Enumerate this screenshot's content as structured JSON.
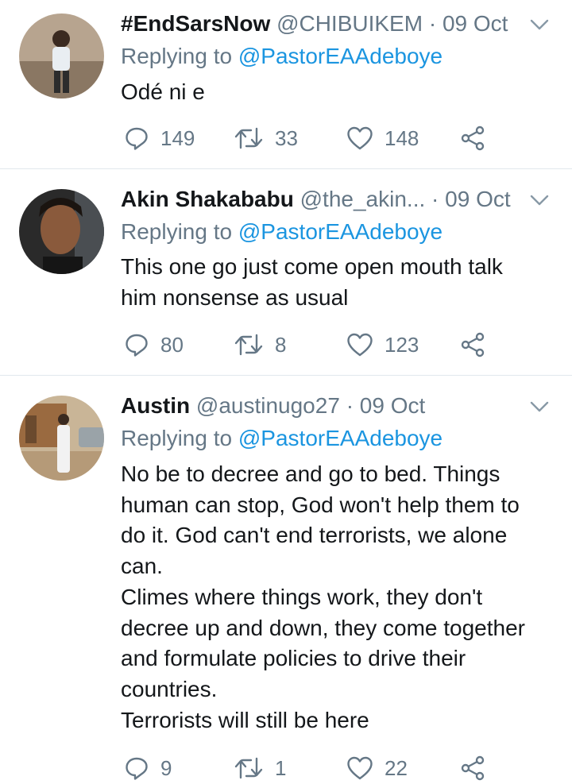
{
  "tweets": [
    {
      "name": "#EndSarsNow",
      "handle": "@CHIBUIKEM",
      "separator": "·",
      "date": "09 Oct",
      "replying_prefix": "Replying to",
      "replying_to": "@PastorEAAdeboye",
      "text": "Odé ni e",
      "replies": "149",
      "retweets": "33",
      "likes": "148"
    },
    {
      "name": "Akin Shakababu",
      "handle": "@the_akin...",
      "separator": "·",
      "date": "09 Oct",
      "replying_prefix": "Replying to",
      "replying_to": "@PastorEAAdeboye",
      "text": "This one go just come open mouth talk\nhim nonsense as usual",
      "replies": "80",
      "retweets": "8",
      "likes": "123"
    },
    {
      "name": "Austin",
      "handle": "@austinugo27",
      "separator": "·",
      "date": "09 Oct",
      "replying_prefix": "Replying to",
      "replying_to": "@PastorEAAdeboye",
      "text": "No be to decree and go to bed. Things\nhuman can stop, God won't help them to\ndo it. God can't end terrorists, we alone\ncan.\nClimes where things work, they don't\ndecree up and down, they come together\nand formulate policies to drive their\ncountries.\nTerrorists will still be here",
      "replies": "9",
      "retweets": "1",
      "likes": "22"
    }
  ],
  "icons": {
    "reply": "reply-icon",
    "retweet": "retweet-icon",
    "like": "like-icon",
    "share": "share-icon",
    "more": "chevron-down-icon"
  },
  "colors": {
    "text": "#14171a",
    "secondary": "#657786",
    "link": "#1b95e0",
    "divider": "#e1e8ed"
  }
}
